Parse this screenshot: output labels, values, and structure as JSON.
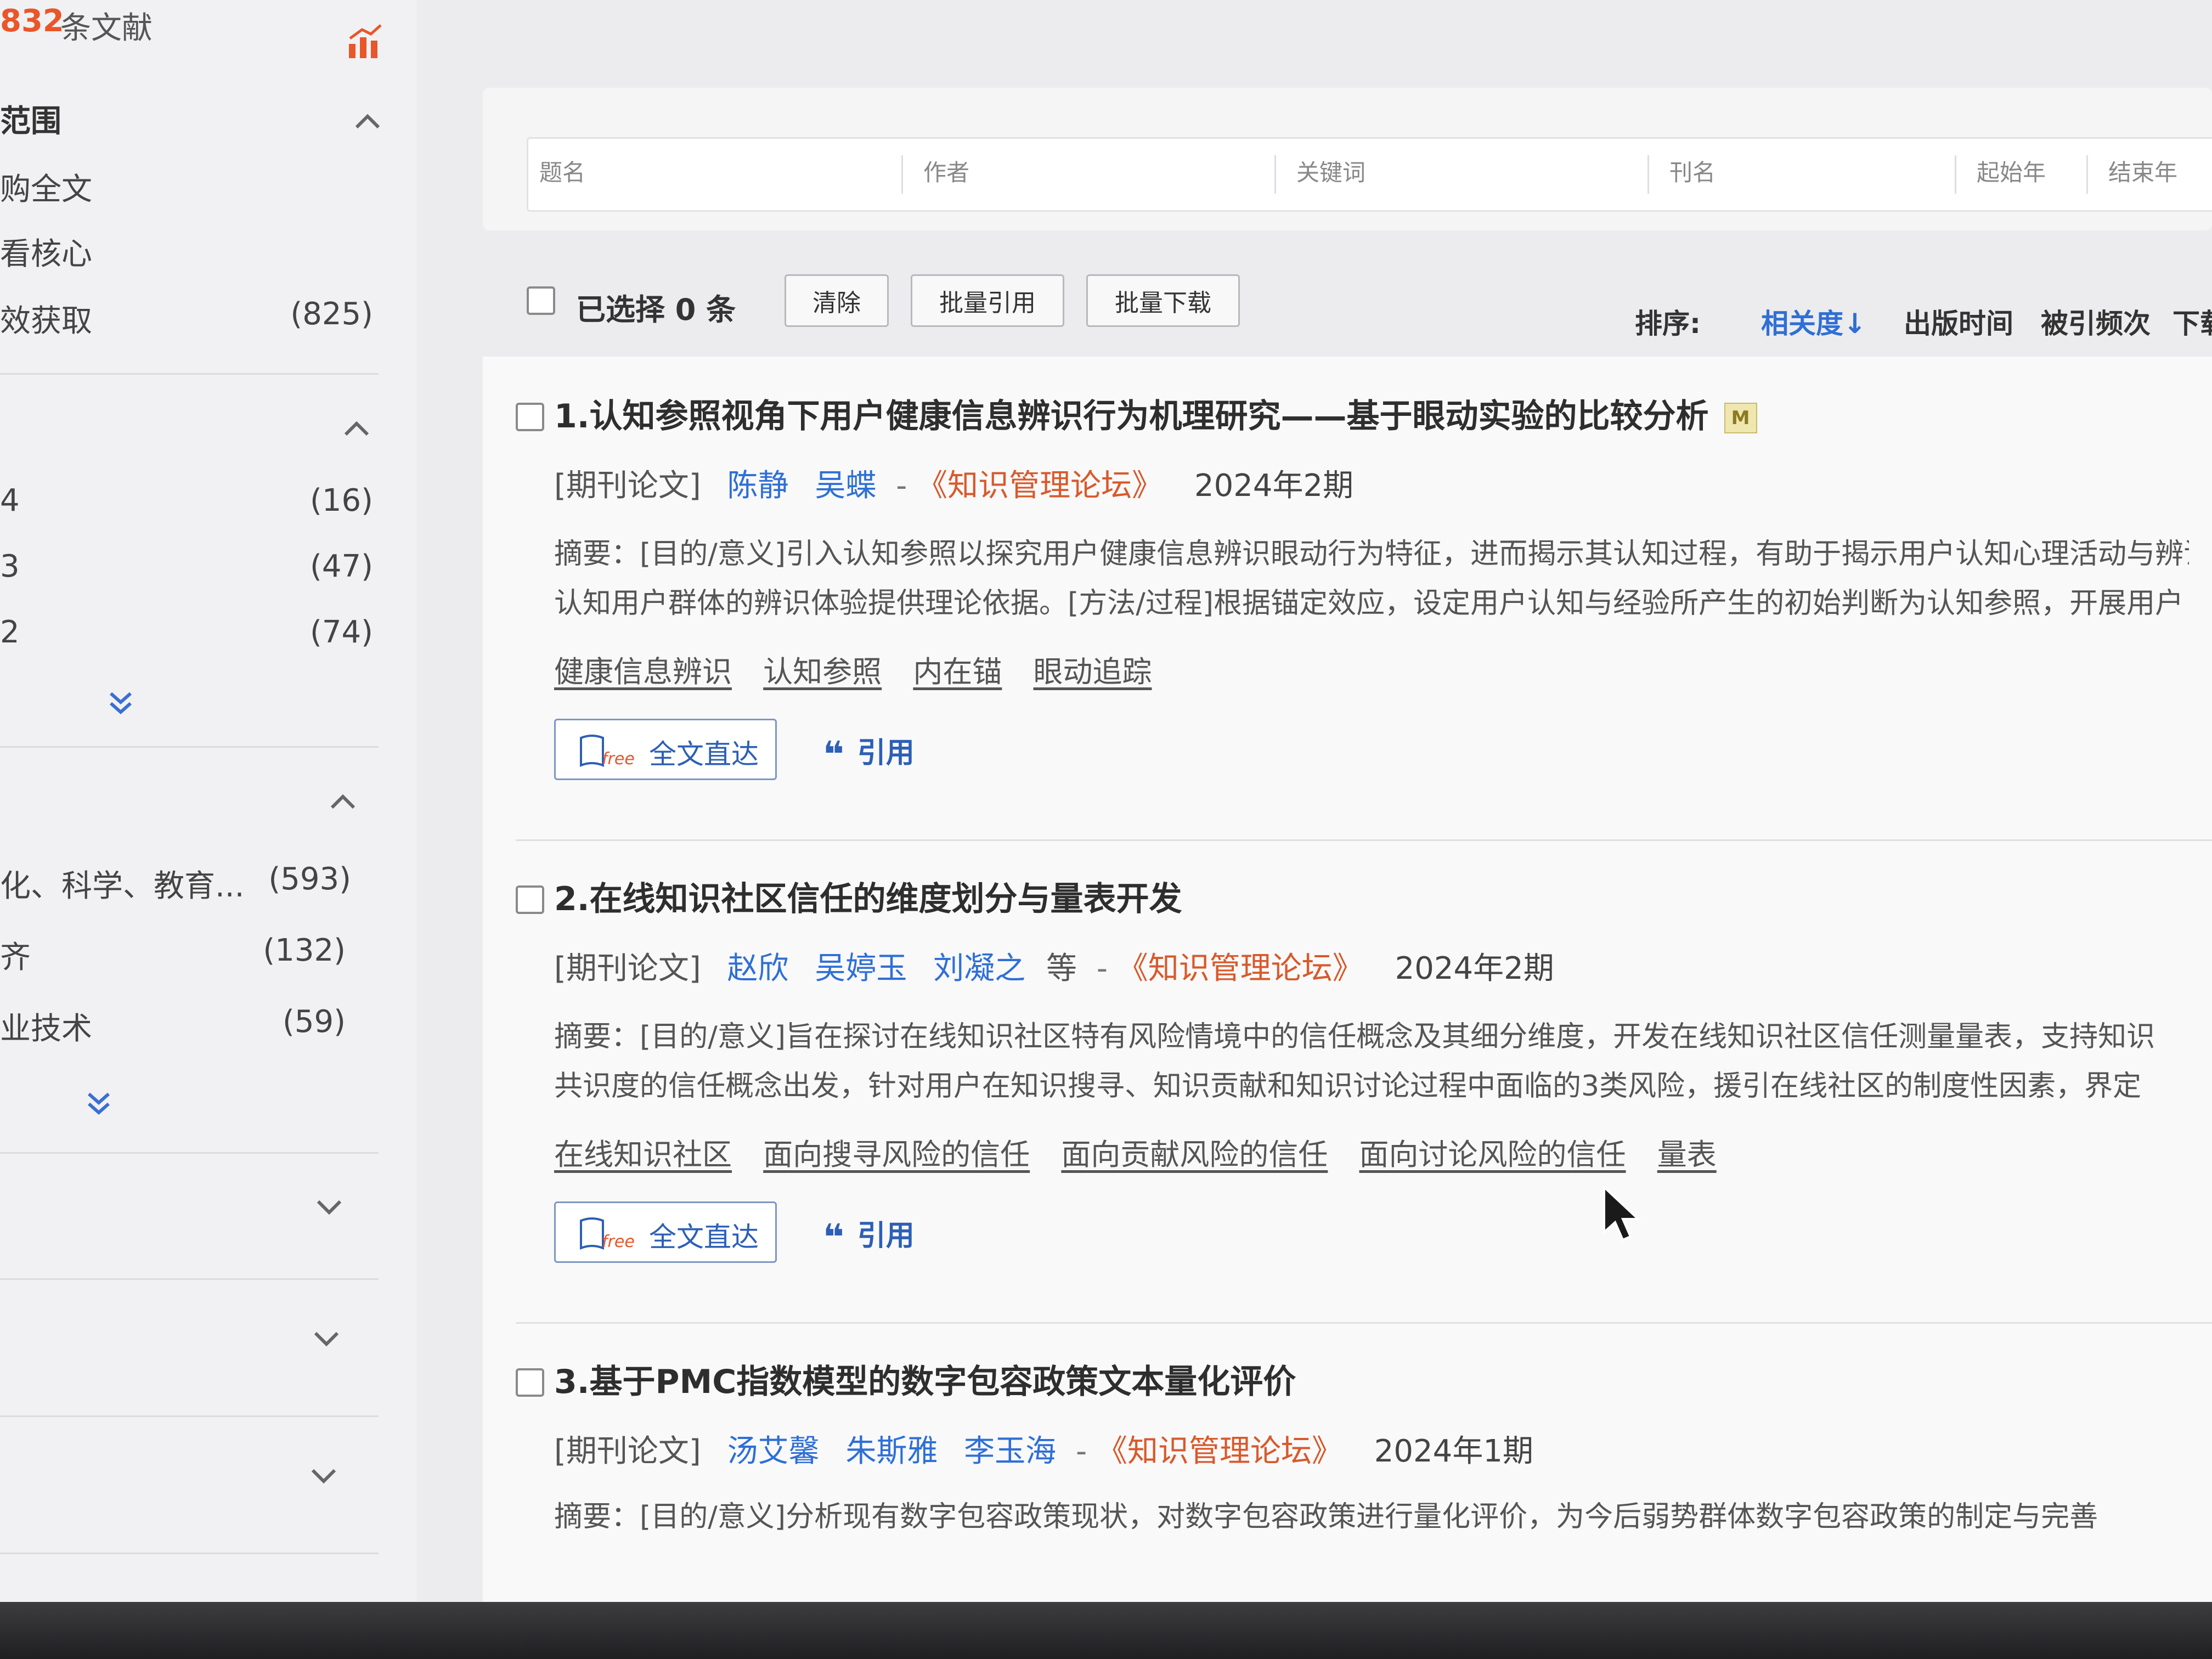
{
  "sidebar": {
    "total_count": "832",
    "total_label": "条文献",
    "sections": [
      {
        "label": "范围",
        "items": [
          {
            "label": "购全文",
            "count": ""
          },
          {
            "label": "看核心",
            "count": ""
          },
          {
            "label": "效获取",
            "count": "(825)"
          }
        ]
      },
      {
        "label": "",
        "items": [
          {
            "label": "4",
            "count": "(16)"
          },
          {
            "label": "3",
            "count": "(47)"
          },
          {
            "label": "2",
            "count": "(74)"
          }
        ]
      },
      {
        "label": "",
        "items": [
          {
            "label": "化、科学、教育...",
            "count": "(593)"
          },
          {
            "label": "齐",
            "count": "(132)"
          },
          {
            "label": "业技术",
            "count": "(59)"
          }
        ]
      }
    ]
  },
  "search": {
    "fields": [
      "题名",
      "作者",
      "关键词",
      "刊名",
      "起始年",
      "结束年"
    ]
  },
  "toolbar": {
    "selected_label": "已选择 0 条",
    "clear_label": "清除",
    "batch_cite_label": "批量引用",
    "batch_download_label": "批量下载",
    "sort_label": "排序:",
    "sort_options": [
      "相关度↓",
      "出版时间",
      "被引频次",
      "下载量"
    ]
  },
  "articles": [
    {
      "title": "1.认知参照视角下用户健康信息辨识行为机理研究——基于眼动实验的比较分析",
      "badge": "M",
      "type": "[期刊论文]",
      "authors": [
        "陈静",
        "吴蝶"
      ],
      "etal": "",
      "journal": "《知识管理论坛》",
      "issue": "2024年2期",
      "abstract_lines": [
        "摘要：[目的/意义]引入认知参照以探究用户健康信息辨识眼动行为特征，进而揭示其认知过程，有助于揭示用户认知心理活动与辨识",
        "认知用户群体的辨识体验提供理论依据。[方法/过程]根据锚定效应，设定用户认知与经验所产生的初始判断为认知参照，开展用户"
      ],
      "keywords": [
        "健康信息辨识",
        "认知参照",
        "内在锚",
        "眼动追踪"
      ],
      "fulltext_label": "全文直达",
      "cite_label": "引用"
    },
    {
      "title": "2.在线知识社区信任的维度划分与量表开发",
      "badge": "",
      "type": "[期刊论文]",
      "authors": [
        "赵欣",
        "吴婷玉",
        "刘凝之"
      ],
      "etal": "等",
      "journal": "《知识管理论坛》",
      "issue": "2024年2期",
      "abstract_lines": [
        "摘要：[目的/意义]旨在探讨在线知识社区特有风险情境中的信任概念及其细分维度，开发在线知识社区信任测量量表，支持知识",
        "共识度的信任概念出发，针对用户在知识搜寻、知识贡献和知识讨论过程中面临的3类风险，援引在线社区的制度性因素，界定"
      ],
      "keywords": [
        "在线知识社区",
        "面向搜寻风险的信任",
        "面向贡献风险的信任",
        "面向讨论风险的信任",
        "量表"
      ],
      "fulltext_label": "全文直达",
      "cite_label": "引用"
    },
    {
      "title": "3.基于PMC指数模型的数字包容政策文本量化评价",
      "badge": "",
      "type": "[期刊论文]",
      "authors": [
        "汤艾馨",
        "朱斯雅",
        "李玉海"
      ],
      "etal": "",
      "journal": "《知识管理论坛》",
      "issue": "2024年1期",
      "abstract_lines": [
        "摘要：[目的/意义]分析现有数字包容政策现状，对数字包容政策进行量化评价，为今后弱势群体数字包容政策的制定与完善"
      ],
      "keywords": [],
      "fulltext_label": "",
      "cite_label": ""
    }
  ]
}
